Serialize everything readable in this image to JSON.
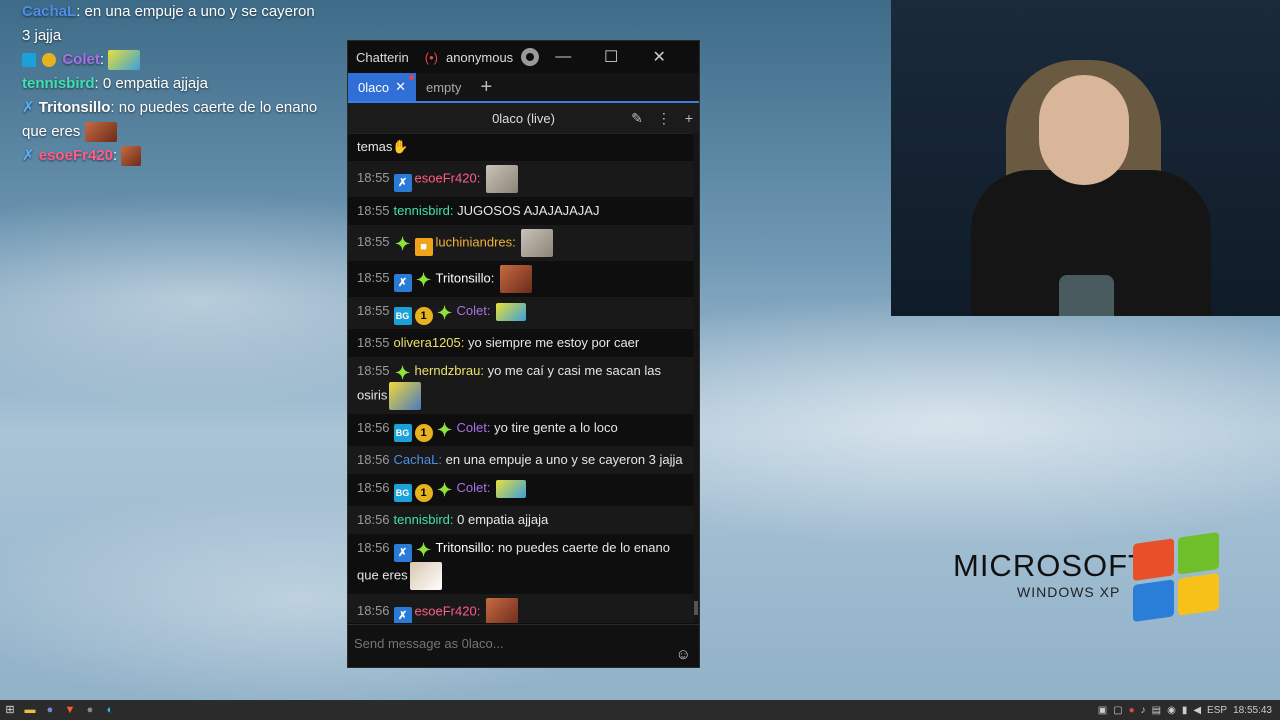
{
  "overlay": {
    "lines": [
      {
        "user": "CachaL",
        "user_color": "#4f8ee8",
        "text": "en una empuje a uno y se cayeron 3 jajja"
      },
      {
        "user": "Colet",
        "user_color": "#a871e8",
        "text": ""
      },
      {
        "user": "tennisbird",
        "user_color": "#40e0b0",
        "text": "0 empatia ajjaja"
      },
      {
        "user": "Tritonsillo",
        "user_color": "#ffffff",
        "text": "no puedes caerte de lo enano que eres"
      },
      {
        "user": "esoeFr420",
        "user_color": "#ff5e8a",
        "text": ""
      }
    ]
  },
  "window": {
    "app_name": "Chatterin",
    "live_icon": "broadcast-icon",
    "account": "anonymous",
    "controls": {
      "minimize": "—",
      "maximize": "☐",
      "close": "✕"
    },
    "tabs": [
      {
        "label": "0laco",
        "active": true,
        "close": "✕"
      },
      {
        "label": "empty",
        "active": false
      }
    ],
    "tab_add": "+",
    "split_title": "0laco (live)"
  },
  "messages": [
    {
      "time": "",
      "user": "",
      "user_color": "#e6e6e6",
      "text": "temas",
      "emote": "clap"
    },
    {
      "time": "18:55",
      "user": "esoeFr420:",
      "user_color": "#ff5e8a",
      "text": "",
      "badges": [
        "mod"
      ],
      "emote": "seal"
    },
    {
      "time": "18:55",
      "user": "tennisbird:",
      "user_color": "#40e0b0",
      "text": "JUGOSOS AJAJAJAJAJ"
    },
    {
      "time": "18:55",
      "user": "luchiniandres:",
      "user_color": "#f0b23a",
      "text": "",
      "badges": [
        "star",
        "box"
      ],
      "emote": "seal"
    },
    {
      "time": "18:55",
      "user": "Tritonsillo:",
      "user_color": "#ffffff",
      "text": "",
      "badges": [
        "mod",
        "star"
      ],
      "emote": "face"
    },
    {
      "time": "18:55",
      "user": "Colet:",
      "user_color": "#a871e8",
      "text": "",
      "badges": [
        "sub",
        "gold",
        "star"
      ],
      "emote": "car"
    },
    {
      "time": "18:55",
      "user": "olivera1205:",
      "user_color": "#e8e06a",
      "text": "yo siempre me estoy por caer"
    },
    {
      "time": "18:55",
      "user": "herndzbrau:",
      "user_color": "#e8e06a",
      "text": "yo me caí y casi me sacan las osiris",
      "badges": [
        "star"
      ],
      "emote": "sponge"
    },
    {
      "time": "18:56",
      "user": "Colet:",
      "user_color": "#a871e8",
      "text": "yo tire gente a lo loco",
      "badges": [
        "sub",
        "gold",
        "star"
      ]
    },
    {
      "time": "18:56",
      "user": "CachaL:",
      "user_color": "#4f8ee8",
      "text": "en una empuje a uno y se cayeron 3 jajja"
    },
    {
      "time": "18:56",
      "user": "Colet:",
      "user_color": "#a871e8",
      "text": "",
      "badges": [
        "sub",
        "gold",
        "star"
      ],
      "emote": "car"
    },
    {
      "time": "18:56",
      "user": "tennisbird:",
      "user_color": "#40e0b0",
      "text": "0 empatia ajjaja"
    },
    {
      "time": "18:56",
      "user": "Tritonsillo:",
      "user_color": "#ffffff",
      "text": "no puedes caerte de lo enano que eres",
      "badges": [
        "mod",
        "star"
      ],
      "emote": "bro"
    },
    {
      "time": "18:56",
      "user": "esoeFr420:",
      "user_color": "#ff5e8a",
      "text": "",
      "badges": [
        "mod"
      ],
      "emote": "face"
    }
  ],
  "input": {
    "placeholder": "Send message as 0laco..."
  },
  "xp_logo": {
    "brand": "MICROSOFT",
    "sub": "WINDOWS XP"
  },
  "taskbar": {
    "lang": "ESP",
    "time": "18:55:43"
  },
  "colors": {
    "accent": "#2f6fd6",
    "live_red": "#e04848"
  }
}
